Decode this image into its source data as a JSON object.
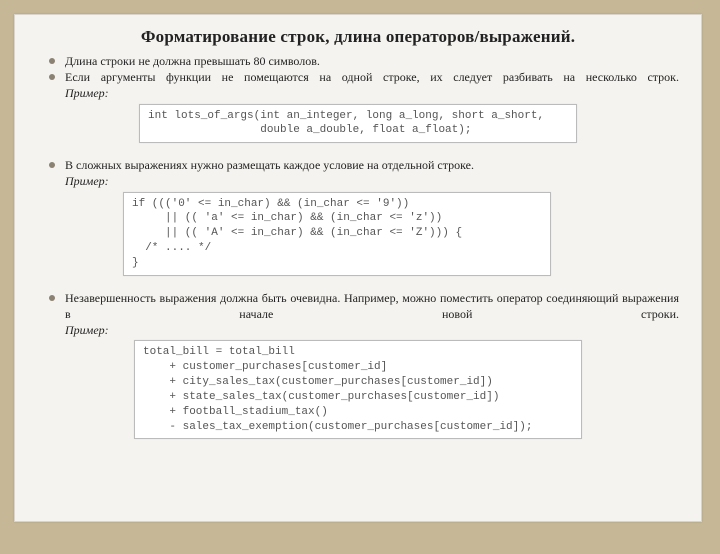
{
  "title": "Форматирование строк, длина операторов/выражений.",
  "bullets": {
    "b1": "Длина строки не должна превышать 80 символов.",
    "b2": "Если аргументы функции не помещаются на одной строке, их следует разбивать на несколько строк.",
    "b3": "В сложных выражениях нужно размещать каждое условие на отдельной строке.",
    "b4": "Незавершенность выражения должна быть очевидна. Например, можно поместить оператор соединяющий выражения в начале новой строки."
  },
  "labels": {
    "example": "Пример:"
  },
  "code": {
    "c1": "int lots_of_args(int an_integer, long a_long, short a_short,\n                 double a_double, float a_float);",
    "c2": "if ((('0' <= in_char) && (in_char <= '9'))\n     || (( 'a' <= in_char) && (in_char <= 'z'))\n     || (( 'A' <= in_char) && (in_char <= 'Z'))) {\n  /* .... */\n}",
    "c3": "total_bill = total_bill\n    + customer_purchases[customer_id]\n    + city_sales_tax(customer_purchases[customer_id])\n    + state_sales_tax(customer_purchases[customer_id])\n    + football_stadium_tax()\n    - sales_tax_exemption(customer_purchases[customer_id]);"
  }
}
